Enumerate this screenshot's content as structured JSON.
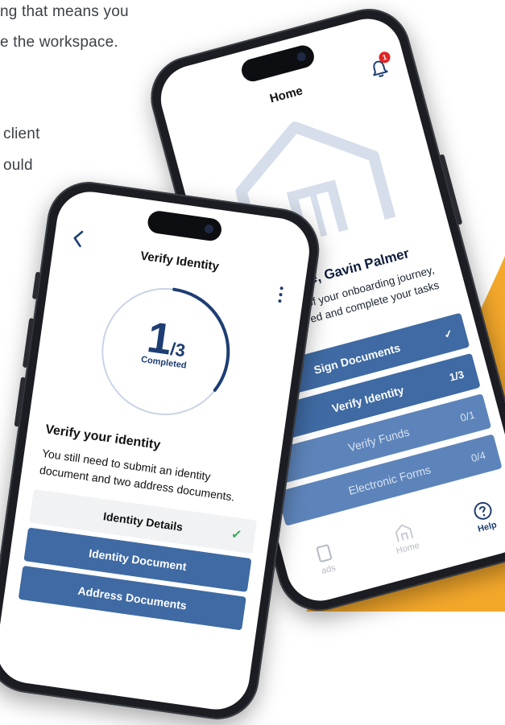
{
  "background": {
    "lines": [
      "ng that means you",
      "e the workspace.",
      "client",
      "ould"
    ],
    "accent_color": "#f4a82b"
  },
  "home_screen": {
    "title": "Home",
    "notification_count": "1",
    "welcome": "Welcome, Gavin Palmer",
    "intro_lines": [
      "the progress of your onboarding journey,",
      "parties involved and complete your tasks"
    ],
    "tasks": [
      {
        "label": "Sign Documents",
        "status": "✓"
      },
      {
        "label": "Verify Identity",
        "status": "1/3"
      },
      {
        "label": "Verify Funds",
        "status": "0/1"
      },
      {
        "label": "Electronic Forms",
        "status": "0/4"
      }
    ],
    "nav": [
      {
        "label": "ads",
        "icon": "documents-icon"
      },
      {
        "label": "Home",
        "icon": "home-icon"
      },
      {
        "label": "Help",
        "icon": "help-icon"
      }
    ]
  },
  "verify_screen": {
    "title": "Verify Identity",
    "progress": {
      "done": "1",
      "total": "/3",
      "label": "Completed",
      "fraction": 0.333
    },
    "heading": "Verify your identity",
    "body": "You still need to submit an identity document and two address documents.",
    "items": [
      {
        "label": "Identity Details",
        "status": "✓"
      },
      {
        "label": "Identity Document"
      },
      {
        "label": "Address Documents"
      }
    ]
  },
  "colors": {
    "primary": "#3f6aa3",
    "navy": "#1e3d73",
    "orange": "#f4a82b",
    "check": "#35a852"
  }
}
